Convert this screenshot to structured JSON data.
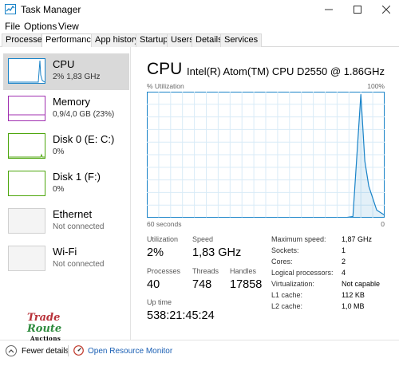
{
  "window": {
    "title": "Task Manager"
  },
  "menu": [
    "File",
    "Options",
    "View"
  ],
  "tabs": [
    "Processes",
    "Performance",
    "App history",
    "Startup",
    "Users",
    "Details",
    "Services"
  ],
  "sidebar": [
    {
      "name": "CPU",
      "sub": "2% 1,83 GHz",
      "color": "#1983c8"
    },
    {
      "name": "Memory",
      "sub": "0,9/4,0 GB (23%)",
      "color": "#a02fb0"
    },
    {
      "name": "Disk 0 (E: C:)",
      "sub": "0%",
      "color": "#4da60c"
    },
    {
      "name": "Disk 1 (F:)",
      "sub": "0%",
      "color": "#4da60c"
    },
    {
      "name": "Ethernet",
      "sub": "Not connected",
      "color": "#999999"
    },
    {
      "name": "Wi-Fi",
      "sub": "Not connected",
      "color": "#999999"
    }
  ],
  "main": {
    "title": "CPU",
    "model": "Intel(R) Atom(TM) CPU D2550 @ 1.86GHz",
    "axis_top_left": "% Utilization",
    "axis_top_right": "100%",
    "axis_bottom_left": "60 seconds",
    "axis_bottom_right": "0"
  },
  "chart_data": {
    "type": "area",
    "x": [
      60,
      56,
      52,
      48,
      44,
      40,
      36,
      32,
      28,
      24,
      20,
      16,
      12,
      10,
      8,
      6,
      5,
      4,
      2,
      0
    ],
    "values": [
      0,
      0,
      0,
      0,
      0,
      0,
      0,
      0,
      0,
      0,
      0,
      0,
      0,
      0,
      1,
      98,
      45,
      25,
      6,
      2
    ],
    "ylim": [
      0,
      100
    ],
    "xlim": [
      60,
      0
    ],
    "grid": true,
    "color": "#1983c8"
  },
  "stats": {
    "utilization": {
      "label": "Utilization",
      "value": "2%"
    },
    "speed": {
      "label": "Speed",
      "value": "1,83 GHz"
    },
    "processes": {
      "label": "Processes",
      "value": "40"
    },
    "threads": {
      "label": "Threads",
      "value": "748"
    },
    "handles": {
      "label": "Handles",
      "value": "17858"
    },
    "uptime": {
      "label": "Up time",
      "value": "538:21:45:24"
    }
  },
  "specs": [
    {
      "label": "Maximum speed:",
      "value": "1,87 GHz"
    },
    {
      "label": "Sockets:",
      "value": "1"
    },
    {
      "label": "Cores:",
      "value": "2"
    },
    {
      "label": "Logical processors:",
      "value": "4"
    },
    {
      "label": "Virtualization:",
      "value": "Not capable"
    },
    {
      "label": "L1 cache:",
      "value": "112 KB"
    },
    {
      "label": "L2 cache:",
      "value": "1,0 MB"
    }
  ],
  "logo": {
    "line1": "Trade",
    "line2": "Route",
    "line3": "Auctions"
  },
  "footer": {
    "fewer": "Fewer details",
    "monitor": "Open Resource Monitor"
  }
}
